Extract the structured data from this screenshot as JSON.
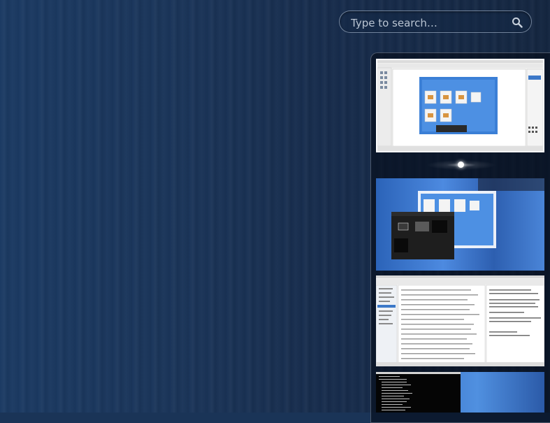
{
  "search": {
    "placeholder": "Type to search…",
    "icon": "search-icon"
  },
  "workspaces": [
    {
      "name": "workspace-1",
      "active": true
    },
    {
      "name": "workspace-2",
      "active": false
    },
    {
      "name": "workspace-3",
      "active": false
    },
    {
      "name": "workspace-4",
      "active": false
    }
  ],
  "colors": {
    "background": "#1a3457",
    "panel": "#0a1424",
    "highlight": "#ffffff"
  }
}
